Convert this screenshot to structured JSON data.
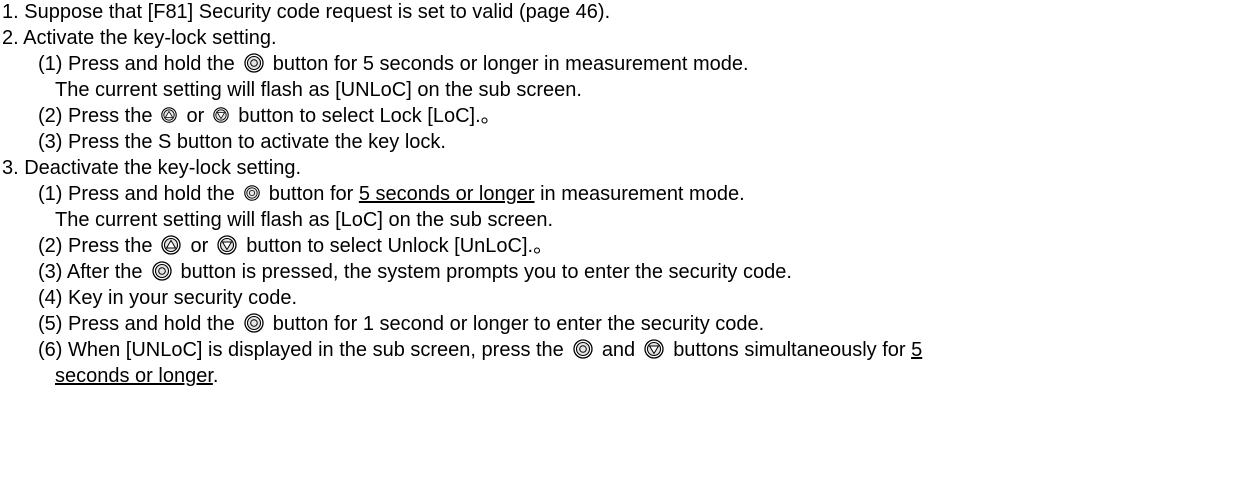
{
  "lines": {
    "l1": "1. Suppose that [F81] Security code request is set to valid (page 46).",
    "l2": "2. Activate the key-lock setting.",
    "l3a": "(1) Press and hold the",
    "l3b": "button for 5 seconds or longer in measurement mode.",
    "l4": "The current setting will flash as [UNLoC] on the sub screen.",
    "l5a": "(2) Press the",
    "l5b": "or",
    "l5c": "button to select Lock [LoC].。",
    "l6": "(3) Press the S button to activate the key lock.",
    "l7": "3. Deactivate the key-lock setting.",
    "l8a": "(1) Press and hold the",
    "l8b": "button for",
    "l8c": "5 seconds or longer",
    "l8d": "in measurement mode.",
    "l9": "The current setting will flash as [LoC] on the sub screen.",
    "l10a": "(2) Press the",
    "l10b": "or",
    "l10c": "button to select Unlock [UnLoC].。",
    "l11a": "(3) After the",
    "l11b": "button is pressed, the system prompts you to enter the security code.",
    "l12": "(4) Key in your security code.",
    "l13a": "(5) Press and hold the",
    "l13b": "button for 1 second or longer to enter the security code.",
    "l14a": "(6) When [UNLoC] is displayed in the sub screen, press the",
    "l14b": "and",
    "l14c": "buttons simultaneously for",
    "l14d": "5",
    "l15a": "seconds or longer",
    "l15b": "."
  },
  "icons": [
    "set-button-icon",
    "up-button-icon",
    "down-button-icon"
  ]
}
